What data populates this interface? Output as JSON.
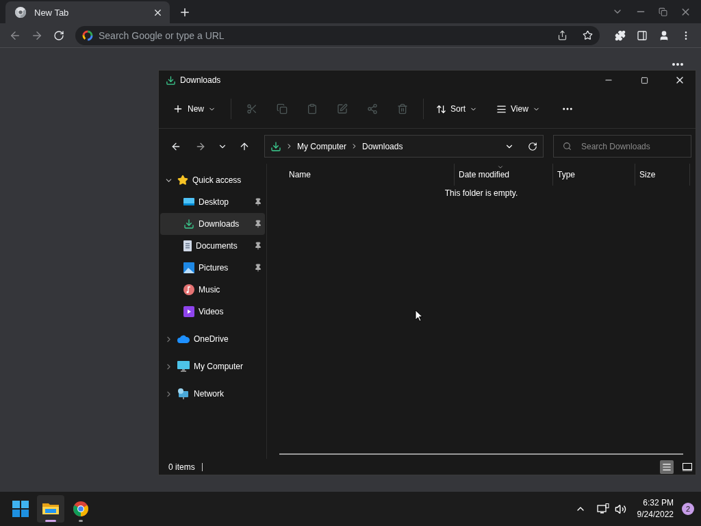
{
  "browser": {
    "tab": {
      "title": "New Tab"
    },
    "omnibox": {
      "placeholder": "Search Google or type a URL"
    }
  },
  "explorer": {
    "title": "Downloads",
    "commands": [
      {
        "kind": "menu",
        "label": "New"
      },
      {
        "kind": "action",
        "disabled": true
      },
      {
        "kind": "action",
        "disabled": true
      },
      {
        "kind": "action",
        "disabled": true
      },
      {
        "kind": "action",
        "disabled": true
      },
      {
        "kind": "action",
        "disabled": true
      },
      {
        "kind": "action",
        "disabled": true
      },
      {
        "kind": "menu",
        "label": "Sort"
      },
      {
        "kind": "menu",
        "label": "View"
      },
      {
        "kind": "more"
      }
    ],
    "nav": {
      "forward_disabled": true
    },
    "breadcrumbs": [
      "My Computer",
      "Downloads"
    ],
    "search": {
      "placeholder": "Search Downloads"
    },
    "sidebar": [
      {
        "label": "Quick access",
        "expanded": true,
        "children": [
          {
            "label": "Desktop",
            "pinned": true,
            "selected": false
          },
          {
            "label": "Downloads",
            "pinned": true,
            "selected": true
          },
          {
            "label": "Documents",
            "pinned": true,
            "selected": false
          },
          {
            "label": "Pictures",
            "pinned": true,
            "selected": false
          },
          {
            "label": "Music",
            "pinned": false,
            "selected": false
          },
          {
            "label": "Videos",
            "pinned": false,
            "selected": false
          }
        ]
      },
      {
        "label": "OneDrive",
        "expanded": false
      },
      {
        "label": "My Computer",
        "expanded": false
      },
      {
        "label": "Network",
        "expanded": false
      }
    ],
    "columns": [
      {
        "label": "Name",
        "sorted": false
      },
      {
        "label": "Date modified",
        "sorted": true
      },
      {
        "label": "Type",
        "sorted": false
      },
      {
        "label": "Size",
        "sorted": false
      }
    ],
    "empty_message": "This folder is empty.",
    "status": "0 items",
    "views": [
      {
        "selected": true
      },
      {
        "selected": false
      }
    ]
  },
  "taskbar": {
    "apps": [
      {
        "active": true
      },
      {
        "active": false
      }
    ],
    "time": "6:32 PM",
    "date": "9/24/2022",
    "notifications": "2"
  }
}
